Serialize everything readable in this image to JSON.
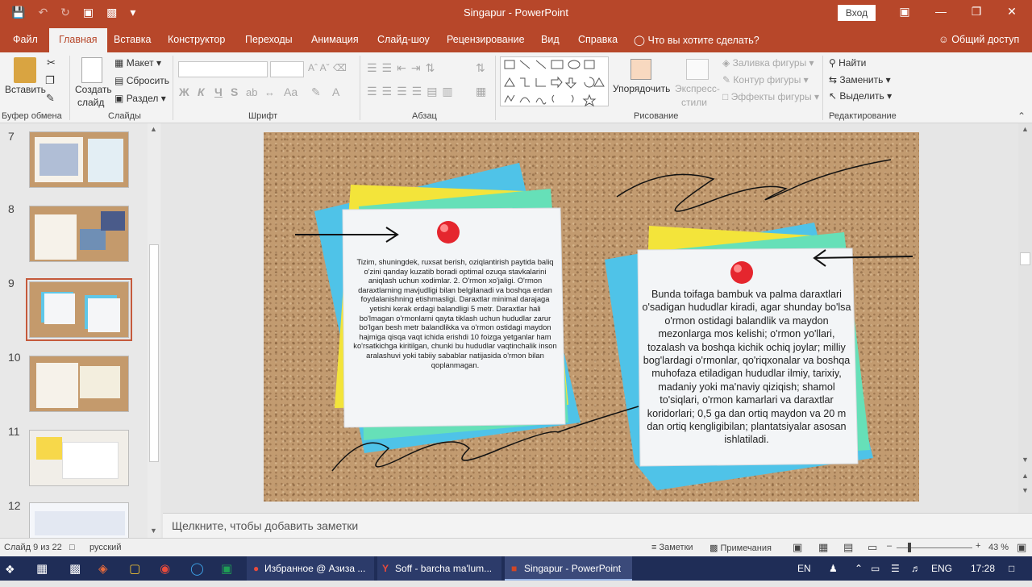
{
  "window": {
    "title": "Singapur  -  PowerPoint",
    "login_label": "Вход"
  },
  "tabs": [
    "Файл",
    "Главная",
    "Вставка",
    "Конструктор",
    "Переходы",
    "Анимация",
    "Слайд-шоу",
    "Рецензирование",
    "Вид",
    "Справка"
  ],
  "tell_me": "Что вы хотите сделать?",
  "share": "Общий доступ",
  "ribbon": {
    "clipboard": {
      "paste": "Вставить",
      "label": "Буфер обмена"
    },
    "slides": {
      "new_slide_1": "Создать",
      "new_slide_2": "слайд",
      "layout": "Макет",
      "reset": "Сбросить",
      "section": "Раздел",
      "label": "Слайды"
    },
    "font": {
      "bold": "Ж",
      "italic": "К",
      "underline": "Ч",
      "strike": "S",
      "case": "Aa",
      "label": "Шрифт"
    },
    "paragraph": {
      "label": "Абзац"
    },
    "drawing": {
      "arrange": "Упорядочить",
      "quick_styles_1": "Экспресс-",
      "quick_styles_2": "стили",
      "fill": "Заливка фигуры",
      "outline": "Контур фигуры",
      "effects": "Эффекты фигуры",
      "label": "Рисование"
    },
    "editing": {
      "find": "Найти",
      "replace": "Заменить",
      "select": "Выделить",
      "label": "Редактирование"
    }
  },
  "thumbnails": [
    "7",
    "8",
    "9",
    "10",
    "11",
    "12"
  ],
  "slide": {
    "left_note": "Tizim, shuningdek, ruxsat berish, oziqlantirish paytida baliq o'zini qanday kuzatib boradi optimal ozuqa stavkalarini aniqlash uchun xodimlar. 2. O'rmon xo'jaligi. O'rmon daraxtlarning mavjudligi bilan belgilanadi va boshqa erdan foydalanishning etishmasligi. Daraxtlar minimal darajaga yetishi kerak erdagi balandligi 5 metr. Daraxtlar hali bo'lmagan o'rmonlarni qayta tiklash uchun hududlar zarur bo'lgan besh metr balandlikka va o'rmon ostidagi maydon hajmiga qisqa vaqt ichida erishdi 10 foizga yetganlar ham ko'rsatkichga kiritilgan, chunki bu hududlar vaqtinchalik inson aralashuvi yoki tabiiy sabablar natijasida o'rmon bilan qoplanmagan.",
    "right_note": "Bunda toifaga bambuk va palma daraxtlari o'sadigan hududlar kiradi, agar shunday bo'lsa o'rmon ostidagi balandlik va maydon mezonlarga mos kelishi; o'rmon yo'llari, tozalash va boshqa kichik ochiq joylar; milliy bog'lardagi o'rmonlar, qo'riqxonalar va boshqa muhofaza etiladigan hududlar ilmiy, tarixiy, madaniy yoki ma'naviy qiziqish; shamol to'siqlari, o'rmon kamarlari va daraxtlar koridorlari; 0,5 ga dan ortiq maydon va 20 m dan ortiq kengligibilan; plantatsiyalar asosan ishlatiladi."
  },
  "notes_placeholder": "Щелкните, чтобы добавить заметки",
  "status": {
    "slide_info": "Слайд 9 из 22",
    "language": "русский",
    "notes_btn": "Заметки",
    "comments_btn": "Примечания",
    "zoom": "43 %"
  },
  "taskbar": {
    "item1": "Избранное @ Азиза ...",
    "item2": "Soff - barcha ma'lum...",
    "item3": "Singapur - PowerPoint",
    "lang": "EN",
    "kbd": "ENG",
    "time": "17:28"
  },
  "colors": {
    "accent": "#b7472a",
    "taskbar": "#1f2d57",
    "cork": "#c29b70"
  }
}
